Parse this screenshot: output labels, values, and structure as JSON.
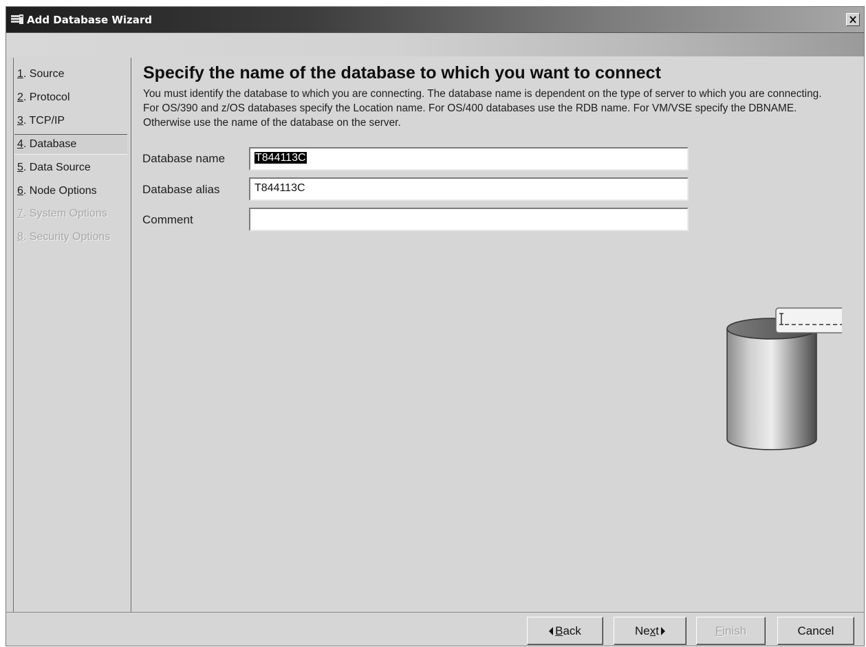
{
  "window": {
    "title": "Add Database Wizard",
    "close_symbol": "×"
  },
  "nav": {
    "items": [
      {
        "num": "1",
        "label": ". Source",
        "enabled": true,
        "selected": false
      },
      {
        "num": "2",
        "label": ". Protocol",
        "enabled": true,
        "selected": false
      },
      {
        "num": "3",
        "label": ". TCP/IP",
        "enabled": true,
        "selected": false
      },
      {
        "num": "4",
        "label": ". Database",
        "enabled": true,
        "selected": true
      },
      {
        "num": "5",
        "label": ". Data Source",
        "enabled": true,
        "selected": false
      },
      {
        "num": "6",
        "label": ". Node Options",
        "enabled": true,
        "selected": false
      },
      {
        "num": "7",
        "label": ". System Options",
        "enabled": false,
        "selected": false
      },
      {
        "num": "8",
        "label": ". Security Options",
        "enabled": false,
        "selected": false
      }
    ]
  },
  "content": {
    "heading": "Specify the name of the database to which you want to connect",
    "description": "You must identify the database to which you are connecting. The database name is dependent on the type of server to which you are connecting. For OS/390 and z/OS databases specify the Location name. For OS/400 databases use the RDB name. For VM/VSE  specify the DBNAME. Otherwise use the name of the database on the server."
  },
  "form": {
    "database_name": {
      "label": "Database name",
      "value": "T844113C"
    },
    "database_alias": {
      "label": "Database alias",
      "value": "T844113C"
    },
    "comment": {
      "label": "Comment",
      "value": ""
    }
  },
  "buttons": {
    "back": {
      "mnemonic": "B",
      "rest": "ack",
      "enabled": true
    },
    "next": {
      "pre": "Ne",
      "mnemonic": "x",
      "rest": "t",
      "enabled": true
    },
    "finish": {
      "mnemonic": "F",
      "rest": "inish",
      "enabled": false
    },
    "cancel": {
      "label": "Cancel",
      "enabled": true
    }
  },
  "illustration": {
    "icon": "database-cylinder-icon",
    "label_icon": "text-cursor-icon"
  }
}
